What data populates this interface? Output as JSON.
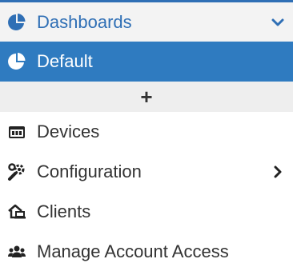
{
  "nav": {
    "header": {
      "label": "Dashboards",
      "icon": "pie-chart-icon",
      "chevron": "chevron-down-icon"
    },
    "selected": {
      "label": "Default",
      "icon": "pie-chart-icon"
    },
    "add": {
      "label": "+"
    },
    "items": [
      {
        "label": "Devices",
        "icon": "device-icon"
      },
      {
        "label": "Configuration",
        "icon": "wrench-gear-icon",
        "chevron": "chevron-right-icon"
      },
      {
        "label": "Clients",
        "icon": "home-laptop-icon"
      },
      {
        "label": "Manage Account Access",
        "icon": "users-icon"
      }
    ]
  },
  "colors": {
    "accent": "#2f6fb5",
    "selected_bg": "#2f7bc0",
    "header_bg": "#f3f3f3",
    "addbar_bg": "#eeeeee",
    "text": "#333333"
  }
}
